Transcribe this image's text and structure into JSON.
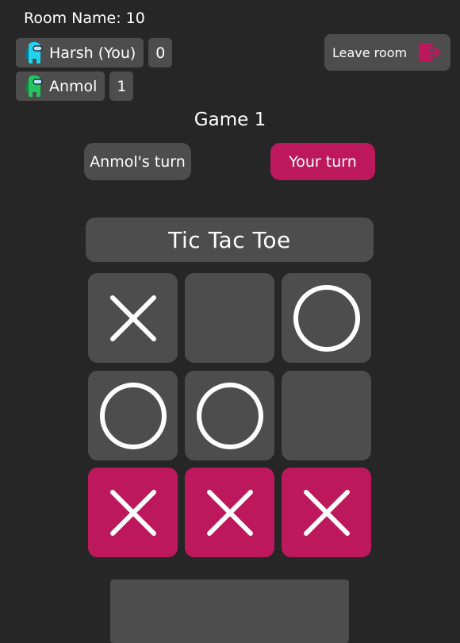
{
  "room": {
    "label": "Room Name: 10"
  },
  "players": [
    {
      "name": "Harsh (You)",
      "score": "0",
      "avatar": "crewmate-cyan-icon",
      "color": "#22d3ee"
    },
    {
      "name": "Anmol",
      "score": "1",
      "avatar": "crewmate-green-icon",
      "color": "#22c55e"
    }
  ],
  "leave": {
    "label": "Leave room",
    "icon": "exit-door-icon"
  },
  "game": {
    "title": "Game 1"
  },
  "turns": {
    "opponent": "Anmol's turn",
    "self": "Your turn"
  },
  "board": {
    "title": "Tic Tac Toe",
    "cells": [
      "X",
      "",
      "O",
      "O",
      "O",
      "",
      "X",
      "X",
      "X"
    ],
    "winning_cells": [
      6,
      7,
      8
    ]
  },
  "colors": {
    "accent": "#be185d",
    "panel": "#4d4d4d",
    "background": "#262626"
  }
}
